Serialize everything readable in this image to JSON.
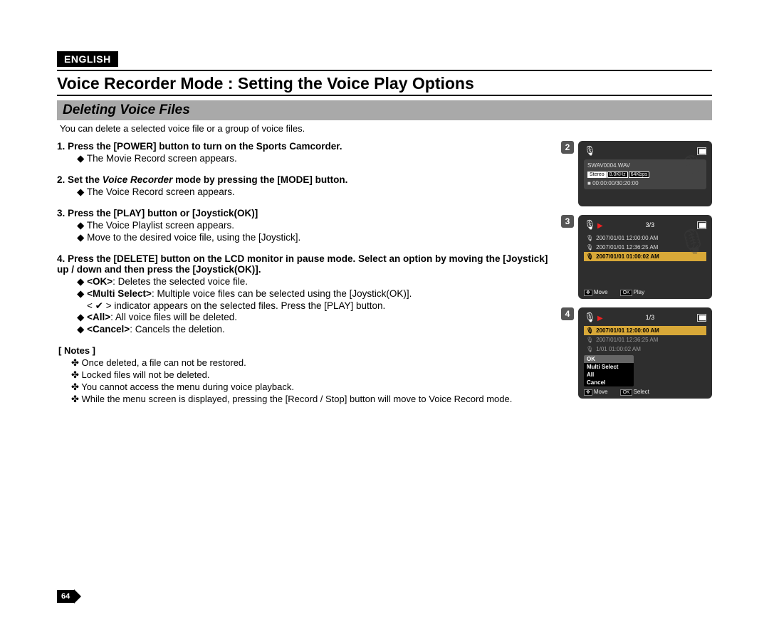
{
  "lang": "ENGLISH",
  "title": "Voice Recorder Mode : Setting the Voice Play Options",
  "subhead": "Deleting Voice Files",
  "intro": "You can delete a selected voice file or a group of voice files.",
  "steps": [
    {
      "head": "1. Press the [POWER] button to turn on the Sports Camcorder.",
      "bullets": [
        "The Movie Record screen appears."
      ]
    },
    {
      "head_pre": "2. Set the ",
      "head_em": "Voice Recorder",
      "head_post": " mode by pressing the [MODE] button.",
      "bullets": [
        "The Voice Record screen appears."
      ]
    },
    {
      "head": "3. Press the [PLAY] button or [Joystick(OK)]",
      "bullets": [
        "The Voice Playlist screen appears.",
        "Move to the desired voice file, using the [Joystick]."
      ]
    },
    {
      "head": "4. Press the [DELETE] button on the LCD monitor in pause mode. Select an option by moving the [Joystick] up / down and then press the [Joystick(OK)].",
      "opts": [
        {
          "k": "<OK>",
          "v": ": Deletes the selected voice file."
        },
        {
          "k": "<Multi Select>",
          "v": ": Multiple voice files can be selected using the [Joystick(OK)].",
          "extra": "< ✔ > indicator appears on the selected files. Press the [PLAY] button."
        },
        {
          "k": "<All>",
          "v": ": All voice files will be deleted."
        },
        {
          "k": "<Cancel>",
          "v": ": Cancels the deletion."
        }
      ]
    }
  ],
  "notes_label": "[ Notes ]",
  "notes": [
    "Once deleted, a file can not be restored.",
    "Locked files will not be deleted.",
    "You cannot access the menu during voice playback.",
    "While the menu screen is displayed, pressing the [Record / Stop] button will move to Voice Record mode."
  ],
  "pagenum": "64",
  "panel2": {
    "num": "2",
    "filename": "SWAV0004.WAV",
    "badges": [
      "Stereo",
      "8.0KHz",
      "64Kbps"
    ],
    "time": "00:00:00/30:20:00"
  },
  "panel3": {
    "num": "3",
    "counter": "3/3",
    "rows": [
      "2007/01/01 12:00:00 AM",
      "2007/01/01 12:36:25 AM",
      "2007/01/01 01:00:02 AM"
    ],
    "hint_move": "Move",
    "hint_play": "Play"
  },
  "panel4": {
    "num": "4",
    "counter": "1/3",
    "rows": [
      "2007/01/01 12:00:00 AM",
      "2007/01/01 12:36:25 AM",
      "1/01 01:00:02 AM"
    ],
    "menu": [
      "OK",
      "Multi Select",
      "All",
      "Cancel"
    ],
    "hint_move": "Move",
    "hint_select": "Select"
  }
}
